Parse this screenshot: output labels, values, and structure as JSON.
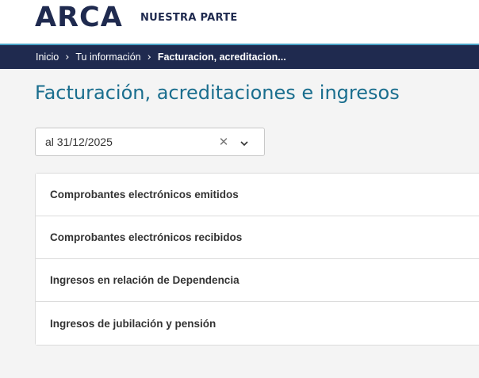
{
  "header": {
    "logo": "ARCA",
    "tagline": "NUESTRA PARTE"
  },
  "breadcrumb": {
    "items": [
      "Inicio",
      "Tu información"
    ],
    "current": "Facturacion, acreditacion..."
  },
  "page": {
    "title": "Facturación, acreditaciones e ingresos"
  },
  "period_select": {
    "value": "al 31/12/2025",
    "clear_glyph": "✕",
    "chevron_glyph": "⌄"
  },
  "sections": [
    "Comprobantes electrónicos emitidos",
    "Comprobantes electrónicos recibidos",
    "Ingresos en relación de Dependencia",
    "Ingresos de jubilación y pensión"
  ],
  "colors": {
    "brand_navy": "#1f2a4f",
    "title_teal": "#1a6e8e",
    "accent_line": "#4aa3c6"
  }
}
